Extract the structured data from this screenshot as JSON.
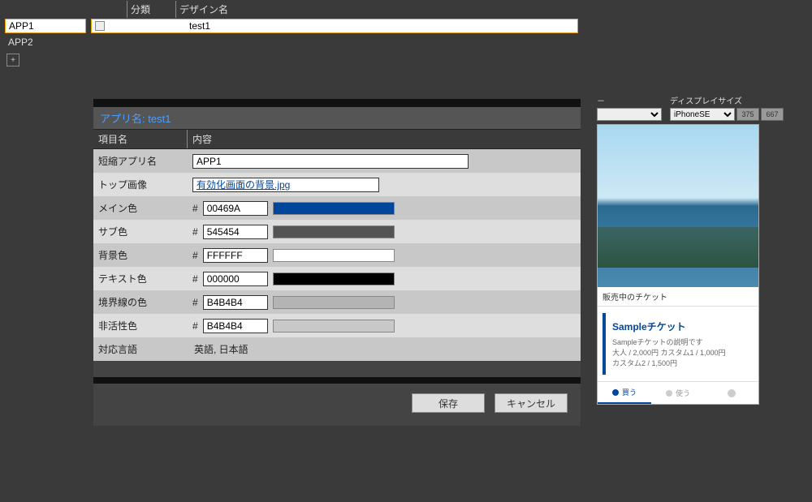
{
  "header": {
    "category": "分類",
    "design_name": "デザイン名"
  },
  "apps": [
    {
      "name": "APP1",
      "design": "test1",
      "checked": false,
      "active": true
    },
    {
      "name": "APP2",
      "design": "",
      "checked": false,
      "active": false
    }
  ],
  "add_label": "+",
  "panel": {
    "title_prefix": "アプリ名:",
    "title_value": "test1",
    "col_item": "項目名",
    "col_value": "内容",
    "rows": {
      "short_name": {
        "label": "短縮アプリ名",
        "value": "APP1"
      },
      "top_image": {
        "label": "トップ画像",
        "value": "有効化画面の背景.jpg"
      },
      "main_color": {
        "label": "メイン色",
        "value": "00469A",
        "swatch": "#00469A"
      },
      "sub_color": {
        "label": "サブ色",
        "value": "545454",
        "swatch": "#545454"
      },
      "bg_color": {
        "label": "背景色",
        "value": "FFFFFF",
        "swatch": "#FFFFFF"
      },
      "text_color": {
        "label": "テキスト色",
        "value": "000000",
        "swatch": "#000000"
      },
      "border_color": {
        "label": "境界線の色",
        "value": "B4B4B4",
        "swatch": "#B4B4B4"
      },
      "inactive_color": {
        "label": "非活性色",
        "value": "B4B4B4",
        "swatch": "#C8C8C8"
      },
      "languages": {
        "label": "対応言語",
        "value": "英語, 日本語"
      }
    },
    "buttons": {
      "save": "保存",
      "cancel": "キャンセル"
    }
  },
  "preview": {
    "spacer_label": "－",
    "sizes_label": "ディスプレイサイズ",
    "device": "iPhoneSE",
    "width": "375",
    "refresh": "667",
    "sub_header": "販売中のチケット",
    "card": {
      "title": "Sampleチケット",
      "subtitle": "Sampleチケットの説明です",
      "line1": "大人 / 2,000円  カスタム1 / 1,000円",
      "line2": "カスタム2 / 1,500円"
    },
    "tabs": {
      "buy": "買う",
      "use": "使う"
    }
  }
}
